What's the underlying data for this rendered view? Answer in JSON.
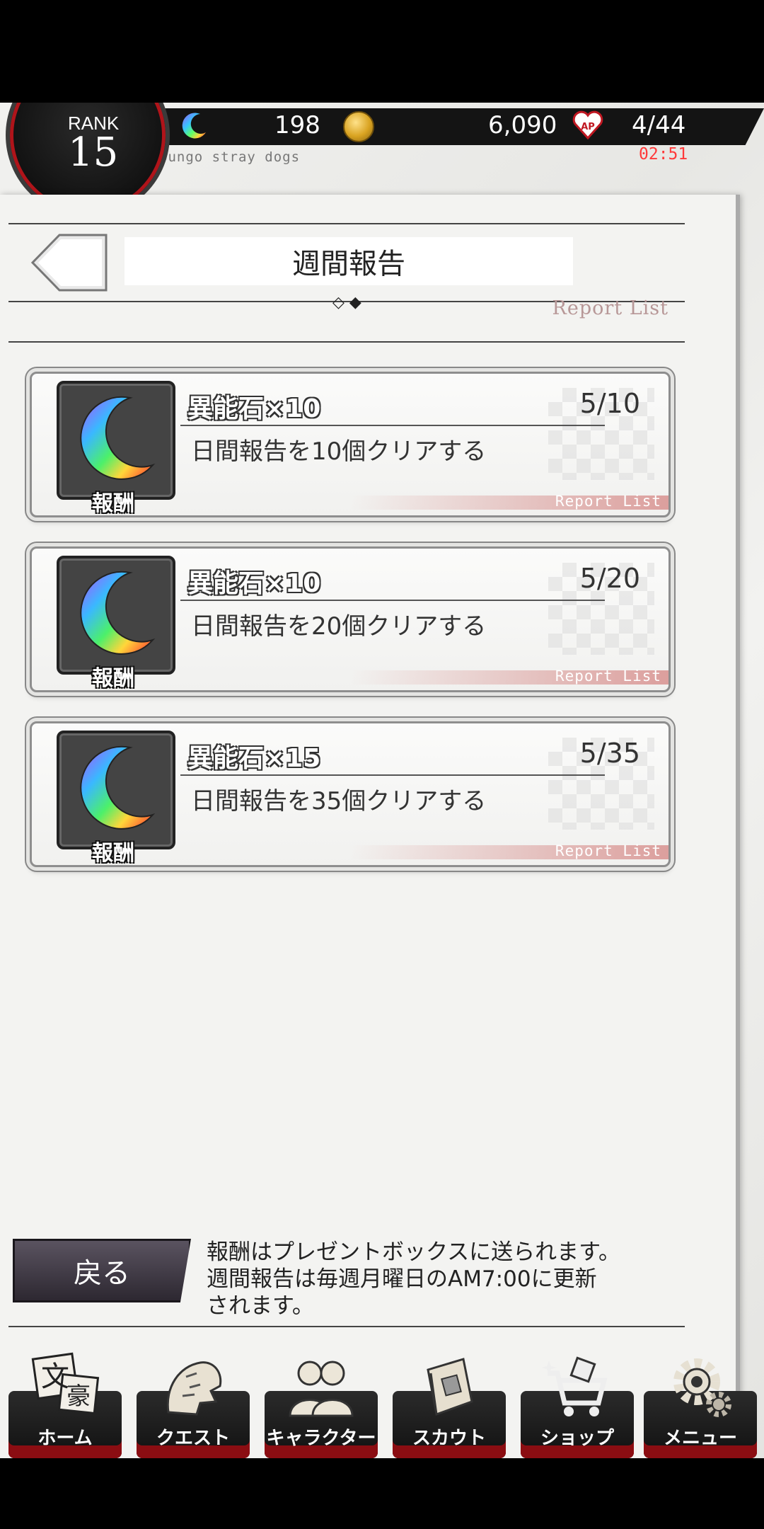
{
  "header": {
    "rank_label": "RANK",
    "rank_value": "15",
    "gems": "198",
    "coins": "6,090",
    "ap": "4/44",
    "ap_timer": "02:51",
    "game_subtitle": "bungo stray dogs",
    "ap_badge": "AP"
  },
  "page": {
    "title": "週間報告",
    "pager_text": "◇ ◆",
    "report_list_label": "Report List"
  },
  "missions": [
    {
      "reward_name": "異能石×10",
      "progress": "5/10",
      "description": "日間報告を10個クリアする",
      "reward_tag": "報酬",
      "report_list": "Report List"
    },
    {
      "reward_name": "異能石×10",
      "progress": "5/20",
      "description": "日間報告を20個クリアする",
      "reward_tag": "報酬",
      "report_list": "Report List"
    },
    {
      "reward_name": "異能石×15",
      "progress": "5/35",
      "description": "日間報告を35個クリアする",
      "reward_tag": "報酬",
      "report_list": "Report List"
    }
  ],
  "footer": {
    "back_label": "戻る",
    "notice_line1": "報酬はプレゼントボックスに送られます。",
    "notice_line2": "週間報告は毎週月曜日のAM7:00に更新",
    "notice_line3": "されます。"
  },
  "nav": {
    "home": "ホーム",
    "quest": "クエスト",
    "character": "キャラクター",
    "scout": "スカウト",
    "shop": "ショップ",
    "menu": "メニュー",
    "home_logo": "文豪"
  },
  "colors": {
    "accent_red": "#b0141a",
    "ap_timer": "#ff3a3a",
    "report_list": "#b79797"
  }
}
